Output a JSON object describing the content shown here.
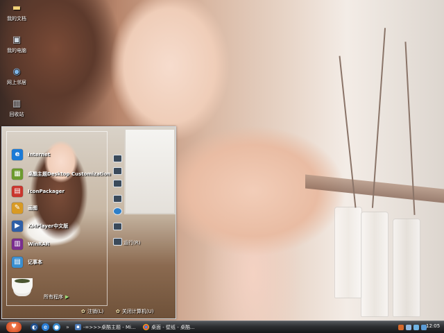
{
  "desktop": {
    "icons": [
      {
        "label": "我的文档",
        "icon": "folder-icon"
      },
      {
        "label": "我的电脑",
        "icon": "computer-icon"
      },
      {
        "label": "网上邻居",
        "icon": "network-icon"
      },
      {
        "label": "回收站",
        "icon": "recycle-bin-icon"
      }
    ]
  },
  "start_menu": {
    "programs": [
      {
        "label": "Internet",
        "icon": "ie-icon",
        "color": "#1a7ad6"
      },
      {
        "label": "桌酷主题Desktop Customization",
        "icon": "theme-app-icon",
        "color": "#6c9a2e"
      },
      {
        "label": "IconPackager",
        "icon": "iconpackager-icon",
        "color": "#c9362d"
      },
      {
        "label": "画图",
        "icon": "paint-icon",
        "color": "#d89a24"
      },
      {
        "label": "KMPlayer中文版",
        "icon": "kmplayer-icon",
        "color": "#2f5fa6"
      },
      {
        "label": "WinRAR",
        "icon": "winrar-icon",
        "color": "#7a2e8f"
      },
      {
        "label": "记事本",
        "icon": "notepad-icon",
        "color": "#3a8fd0"
      }
    ],
    "all_programs": "所有程序",
    "right_label": "运行(R)",
    "log_off": "注销(L)",
    "shutdown": "关闭计算机(U)"
  },
  "taskbar": {
    "buttons": [
      {
        "label": "-=>>>桌酷主题 - Mi...",
        "icon": "app-window-icon"
      },
      {
        "label": "桌面 - 壁纸 - 桌酷...",
        "icon": "chrome-icon"
      }
    ],
    "clock": "12:05"
  }
}
